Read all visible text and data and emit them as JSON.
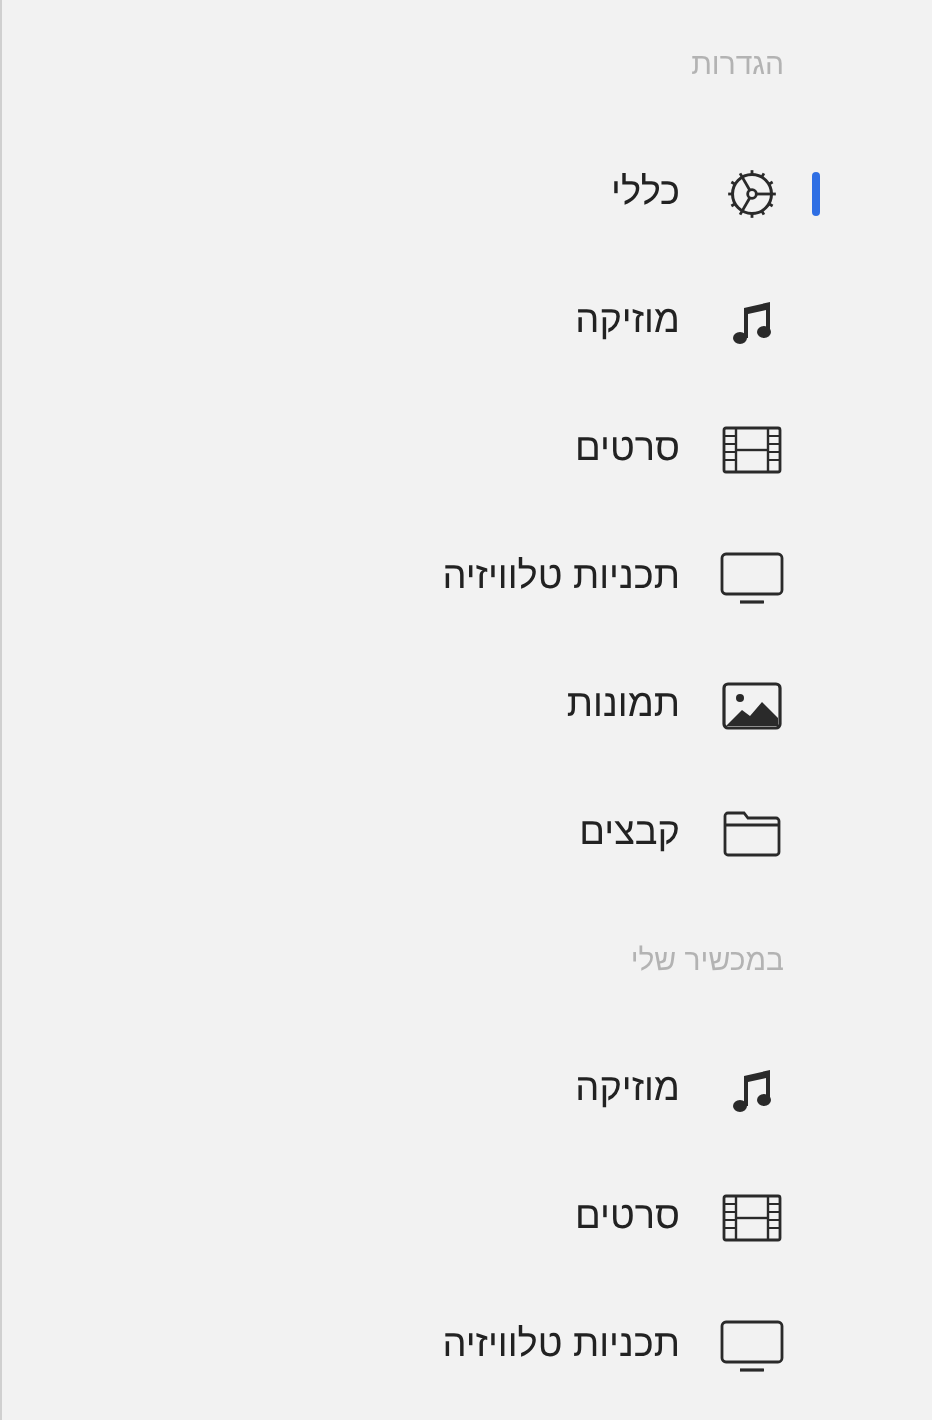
{
  "sections": [
    {
      "title": "הגדרות",
      "items": [
        {
          "label": "כללי",
          "kind": "gear",
          "selected": true
        },
        {
          "label": "מוזיקה",
          "kind": "music",
          "selected": false
        },
        {
          "label": "סרטים",
          "kind": "film",
          "selected": false
        },
        {
          "label": "תכניות טלוויזיה",
          "kind": "tv",
          "selected": false
        },
        {
          "label": "תמונות",
          "kind": "photo",
          "selected": false
        },
        {
          "label": "קבצים",
          "kind": "folder",
          "selected": false
        }
      ]
    },
    {
      "title": "במכשיר שלי",
      "items": [
        {
          "label": "מוזיקה",
          "kind": "music",
          "selected": false
        },
        {
          "label": "סרטים",
          "kind": "film",
          "selected": false
        },
        {
          "label": "תכניות טלוויזיה",
          "kind": "tv",
          "selected": false
        }
      ]
    }
  ]
}
